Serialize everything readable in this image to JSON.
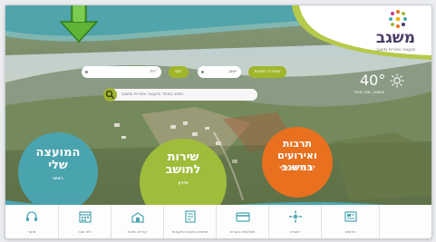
{
  "site": {
    "name": "משגב",
    "tagline": "מועצה אזורית משגב"
  },
  "search": {
    "street_label": "רח'",
    "number_label": "מס'",
    "settlement_label": "ישוב",
    "go_label": "חפש",
    "address_go_label": "שמירת כתובת",
    "free_search_placeholder": "חפש באתר מועצה אזורית משגב"
  },
  "weather": {
    "temp": "40°",
    "label": "משגב, מזג אוויר"
  },
  "circles": {
    "council": {
      "title_line1": "המועצה",
      "title_line2": "שלי",
      "sub": "ראשי"
    },
    "service": {
      "title_line1": "שירות",
      "title_line2": "לתושב",
      "sub": "מידע"
    },
    "events": {
      "title_line1": "תרבות",
      "title_line2": "ואירועים במשגב",
      "sub": "לוח אירועים מלא"
    }
  },
  "bottom_nav": [
    {
      "label": "מוקד",
      "icon": "headset-icon"
    },
    {
      "label": "לוח שנה",
      "icon": "calendar-icon"
    },
    {
      "label": "קהילה ופנאי",
      "icon": "community-icon"
    },
    {
      "label": "טפסים ובקשות מקוונות",
      "icon": "forms-icon"
    },
    {
      "label": "תשלומים ואגרות",
      "icon": "payments-icon"
    },
    {
      "label": "ישובים",
      "icon": "settlements-icon"
    },
    {
      "label": "חדשות",
      "icon": "news-icon"
    }
  ],
  "colors": {
    "teal": "#4aa5b1",
    "green": "#9fbd3b",
    "orange": "#e8701e",
    "purple": "#4a3b63",
    "lime": "#a0b62a"
  }
}
